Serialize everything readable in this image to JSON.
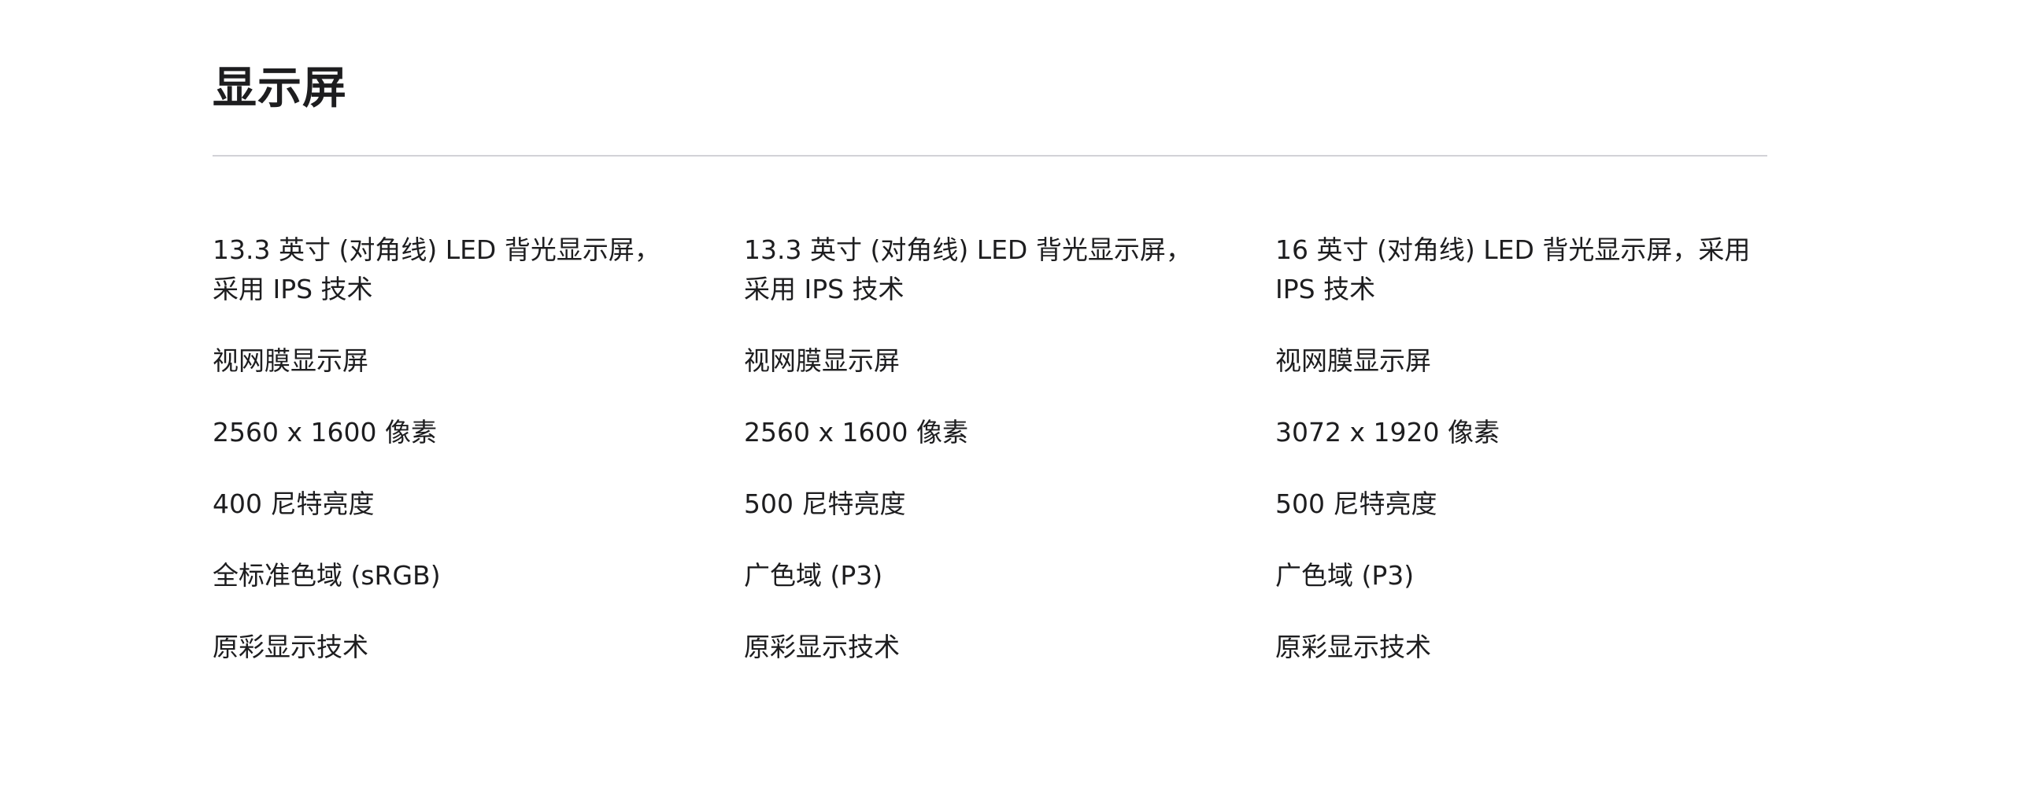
{
  "section": {
    "title": "显示屏"
  },
  "models": [
    {
      "specs": [
        "13.3 英寸 (对角线) LED 背光显示屏，采用 IPS 技术",
        "视网膜显示屏",
        "2560 x 1600 像素",
        "400 尼特亮度",
        "全标准色域 (sRGB)",
        "原彩显示技术"
      ]
    },
    {
      "specs": [
        "13.3 英寸 (对角线) LED 背光显示屏，采用 IPS 技术",
        "视网膜显示屏",
        "2560 x 1600 像素",
        "500 尼特亮度",
        "广色域 (P3)",
        "原彩显示技术"
      ]
    },
    {
      "specs": [
        "16 英寸 (对角线) LED 背光显示屏，采用 IPS 技术",
        "视网膜显示屏",
        "3072 x 1920 像素",
        "500 尼特亮度",
        "广色域 (P3)",
        "原彩显示技术"
      ]
    }
  ],
  "colors": {
    "text": "#1d1d1f",
    "divider": "#d2d2d7",
    "background": "#ffffff"
  }
}
